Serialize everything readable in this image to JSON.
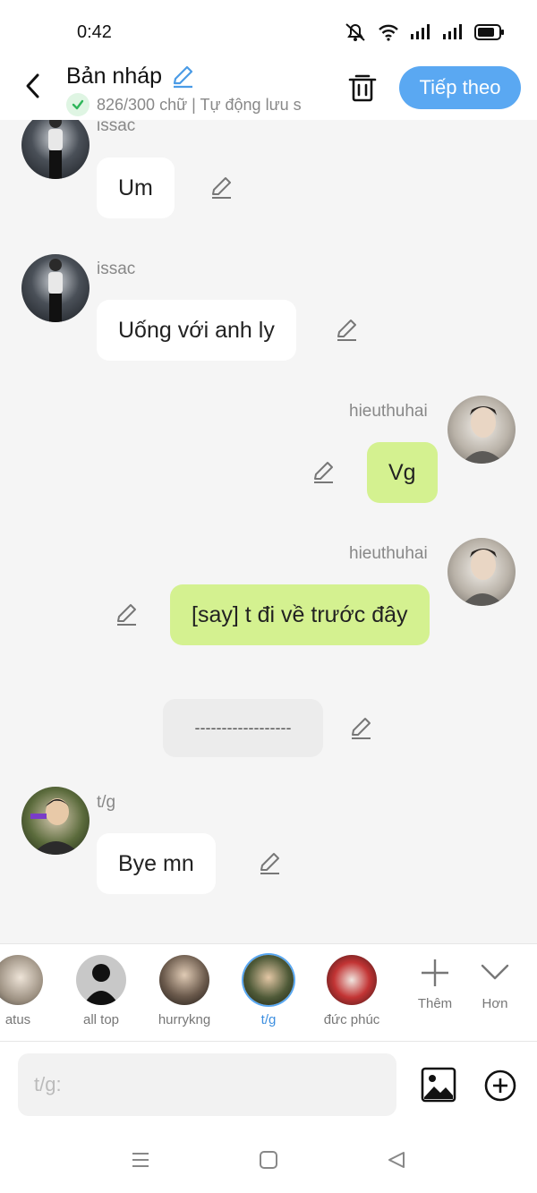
{
  "status": {
    "time": "0:42"
  },
  "header": {
    "title": "Bản nháp",
    "subtitle": "826/300 chữ | Tự động lưu s",
    "next_label": "Tiếp theo"
  },
  "messages": [
    {
      "speaker": "issac",
      "text": "Um",
      "side": "left",
      "style": "white"
    },
    {
      "speaker": "issac",
      "text": "Uống với anh ly",
      "side": "left",
      "style": "white"
    },
    {
      "speaker": "hieuthuhai",
      "text": "Vg",
      "side": "right",
      "style": "green"
    },
    {
      "speaker": "hieuthuhai",
      "text": "[say] t đi về trước đây",
      "side": "right",
      "style": "green"
    },
    {
      "speaker": "",
      "text": "------------------",
      "side": "center",
      "style": "grey"
    },
    {
      "speaker": "t/g",
      "text": "Bye mn",
      "side": "left",
      "style": "white"
    }
  ],
  "characters": [
    {
      "label": "atus"
    },
    {
      "label": "all top"
    },
    {
      "label": "hurrykng"
    },
    {
      "label": "t/g",
      "selected": true
    },
    {
      "label": "đức phúc"
    }
  ],
  "tools": {
    "add_label": "Thêm",
    "more_label": "Hơn"
  },
  "input": {
    "placeholder": "t/g:"
  },
  "colors": {
    "accent": "#5aa8f2",
    "bubble_green": "#d4f190",
    "bubble_white": "#ffffff"
  },
  "icons": [
    "back-icon",
    "pencil-icon",
    "check-icon",
    "trash-icon",
    "image-icon",
    "plus-circle-icon",
    "plus-icon",
    "chevron-down-icon",
    "menu-icon",
    "home-square-icon",
    "back-triangle-icon"
  ]
}
